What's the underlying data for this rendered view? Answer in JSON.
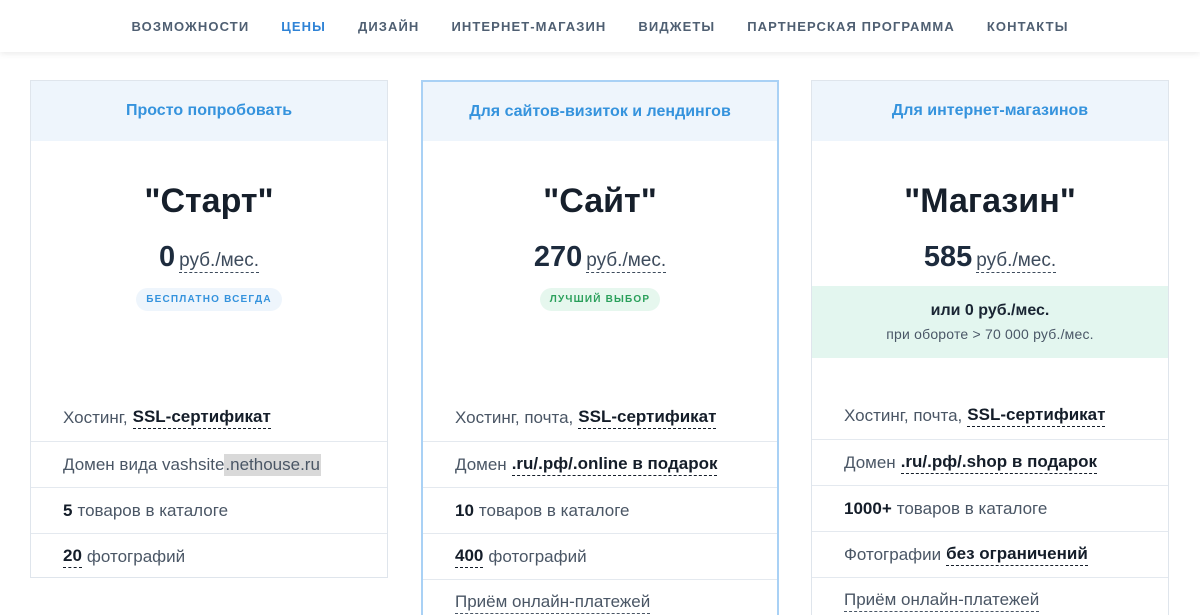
{
  "nav": {
    "items": [
      {
        "label": "ВОЗМОЖНОСТИ"
      },
      {
        "label": "ЦЕНЫ"
      },
      {
        "label": "ДИЗАЙН"
      },
      {
        "label": "ИНТЕРНЕТ-МАГАЗИН"
      },
      {
        "label": "ВИДЖЕТЫ"
      },
      {
        "label": "ПАРТНЕРСКАЯ ПРОГРАММА"
      },
      {
        "label": "КОНТАКТЫ"
      }
    ],
    "active_index": 1,
    "active_color": "#2f83d6"
  },
  "plans": [
    {
      "header": "Просто попробовать",
      "name": "\"Старт\"",
      "price": "0",
      "unit": "руб./мес.",
      "badge": "БЕСПЛАТНО ВСЕГДА",
      "features": {
        "f1_text": "Хостинг, ",
        "f1_bold": "SSL-сертификат",
        "f2_text": "Домен вида vashsite",
        "f2_hl": ".nethouse.ru",
        "f3_bold": "5",
        "f3_text": "товаров в каталоге",
        "f4_bold": "20",
        "f4_text": "фотографий"
      }
    },
    {
      "header": "Для сайтов-визиток и лендингов",
      "name": "\"Сайт\"",
      "price": "270",
      "unit": "руб./мес.",
      "badge": "ЛУЧШИЙ ВЫБОР",
      "features": {
        "f1_text": "Хостинг, почта, ",
        "f1_bold": "SSL-сертификат",
        "f2_text": "Домен ",
        "f2_bold": ".ru/.рф/.online в подарок",
        "f3_bold": "10",
        "f3_text": "товаров в каталоге",
        "f4_bold": "400",
        "f4_text": "фотографий",
        "f5_text": "Приём онлайн-платежей"
      }
    },
    {
      "header": "Для интернет-магазинов",
      "name": "\"Магазин\"",
      "price": "585",
      "unit": "руб./мес.",
      "promo_main": "или 0 руб./мес.",
      "promo_sub": "при обороте > 70 000 руб./мес.",
      "features": {
        "f1_text": "Хостинг, почта, ",
        "f1_bold": "SSL-сертификат",
        "f2_text": "Домен ",
        "f2_bold": ".ru/.рф/.shop в подарок",
        "f3_bold": "1000+",
        "f3_text": "товаров в каталоге",
        "f4_text": "Фотографии ",
        "f4_bold": "без ограничений",
        "f5_text": "Приём онлайн-платежей"
      }
    }
  ],
  "colors": {
    "accent": "#3593dd",
    "badge_green": "#2aa05b",
    "promo_bg": "#e3f6ef",
    "header_bg": "#eef5fc"
  }
}
